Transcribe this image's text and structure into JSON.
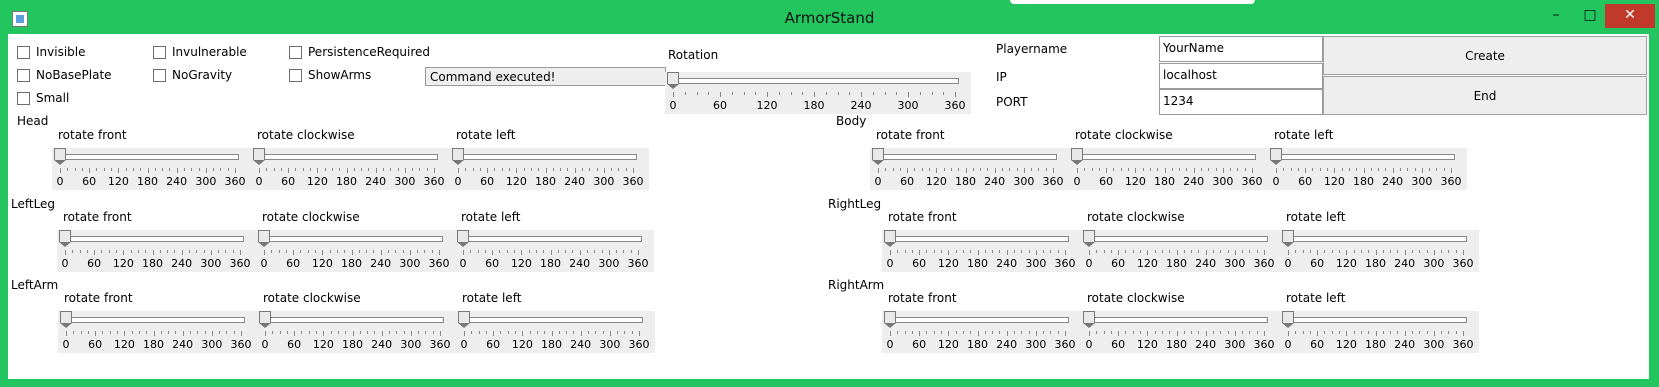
{
  "window": {
    "title": "ArmorStand"
  },
  "controls": {
    "minimize": "–",
    "maximize": "□",
    "close": "✕"
  },
  "checkboxes": [
    "Invisible",
    "Invulnerable",
    "PersistenceRequired",
    "NoBasePlate",
    "NoGravity",
    "ShowArms",
    "Small"
  ],
  "status": "Command executed!",
  "rotation": {
    "label": "Rotation",
    "value": 0,
    "ticks": [
      "0",
      "60",
      "120",
      "180",
      "240",
      "300",
      "360"
    ]
  },
  "form": {
    "playername_label": "Playername",
    "ip_label": "IP",
    "port_label": "PORT",
    "playername": "YourName",
    "ip": "localhost",
    "port": "1234"
  },
  "buttons": {
    "create": "Create",
    "end": "End"
  },
  "slider_labels": {
    "front": "rotate front",
    "clockwise": "rotate clockwise",
    "left": "rotate left"
  },
  "ticks": [
    "0",
    "60",
    "120",
    "180",
    "240",
    "300",
    "360"
  ],
  "parts": [
    {
      "name": "Head",
      "values": [
        0,
        0,
        0
      ]
    },
    {
      "name": "Body",
      "values": [
        0,
        0,
        0
      ]
    },
    {
      "name": "LeftLeg",
      "values": [
        0,
        0,
        0
      ]
    },
    {
      "name": "RightLeg",
      "values": [
        0,
        0,
        0
      ]
    },
    {
      "name": "LeftArm",
      "values": [
        0,
        0,
        0
      ]
    },
    {
      "name": "RightArm",
      "values": [
        0,
        0,
        0
      ]
    }
  ]
}
